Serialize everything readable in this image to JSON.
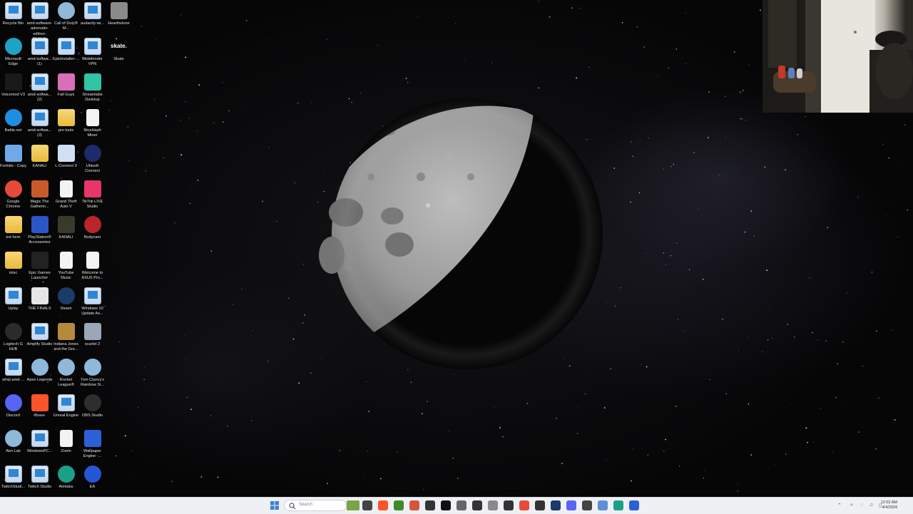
{
  "desktop": {
    "columns": [
      [
        {
          "label": "Recycle Bin",
          "icon": "recycle-bin-icon",
          "style": "file",
          "color": "#dfe9f5"
        },
        {
          "label": "Microsoft Edge",
          "icon": "edge-icon",
          "style": "round",
          "color": "#1fa2c7"
        },
        {
          "label": "Voicemod V3",
          "icon": "voicemod-icon",
          "style": "solid",
          "color": "#1a1a1a"
        },
        {
          "label": "Battle.net",
          "icon": "battlenet-icon",
          "style": "round",
          "color": "#1f8ee0"
        },
        {
          "label": "Fortnite - Copy",
          "icon": "fortnite-icon",
          "style": "solid",
          "color": "#6fa9e8"
        },
        {
          "label": "Google Chrome",
          "icon": "chrome-icon",
          "style": "round",
          "color": "#e84a3a"
        },
        {
          "label": "ext here",
          "icon": "folder-icon",
          "style": "folder",
          "color": "#f0c654"
        },
        {
          "label": "misc",
          "icon": "folder-icon",
          "style": "folder",
          "color": "#f0c654"
        },
        {
          "label": "Uplay",
          "icon": "uplay-icon",
          "style": "file",
          "color": "#dfe9f5"
        },
        {
          "label": "Logitech G HUB",
          "icon": "logitech-icon",
          "style": "round",
          "color": "#2b2b2b"
        },
        {
          "label": "whql-amd-...",
          "icon": "file-icon",
          "style": "file",
          "color": "#dfe9f5"
        },
        {
          "label": "Discord",
          "icon": "discord-icon",
          "style": "round",
          "color": "#5865f2"
        },
        {
          "label": "Aim Lab",
          "icon": "aimlab-icon",
          "style": "round",
          "color": "#8fb9d8"
        },
        {
          "label": "TwitchStudi...",
          "icon": "file-icon",
          "style": "file",
          "color": "#dfe9f5"
        }
      ],
      [
        {
          "label": "amd-software-adrenalin-edition-22.11.2-minimal...",
          "icon": "file-icon",
          "style": "file",
          "color": "#dfe9f5"
        },
        {
          "label": "amd-softwa... (1)",
          "icon": "file-icon",
          "style": "file",
          "color": "#dfe9f5"
        },
        {
          "label": "amd-softwa... (2)",
          "icon": "file-icon",
          "style": "file",
          "color": "#dfe9f5"
        },
        {
          "label": "amd-softwa... (3)",
          "icon": "file-icon",
          "style": "file",
          "color": "#dfe9f5"
        },
        {
          "label": "KANALI",
          "icon": "folder-icon",
          "style": "folder",
          "color": "#f0c654"
        },
        {
          "label": "Magic The Gatherin...",
          "icon": "magic-icon",
          "style": "solid",
          "color": "#c85a2a"
        },
        {
          "label": "PlayStation® Accessories",
          "icon": "playstation-icon",
          "style": "solid",
          "color": "#2a56c6"
        },
        {
          "label": "Epic Games Launcher",
          "icon": "epic-games-icon",
          "style": "solid",
          "color": "#222222"
        },
        {
          "label": "THE FINALS",
          "icon": "the-finals-icon",
          "style": "solid",
          "color": "#e6e6e6"
        },
        {
          "label": "Amplify Studio",
          "icon": "file-icon",
          "style": "file",
          "color": "#dfe9f5"
        },
        {
          "label": "Apex Legends",
          "icon": "apex-icon",
          "style": "round",
          "color": "#8fb9d8"
        },
        {
          "label": "Brave",
          "icon": "brave-icon",
          "style": "solid",
          "color": "#fb542b"
        },
        {
          "label": "WindowsPC...",
          "icon": "file-icon",
          "style": "file",
          "color": "#dfe9f5"
        },
        {
          "label": "Twitch Studio",
          "icon": "file-icon",
          "style": "file",
          "color": "#dfe9f5"
        }
      ],
      [
        {
          "label": "Call of Duty® M...",
          "icon": "call-of-duty-icon",
          "style": "round",
          "color": "#8fb9d8"
        },
        {
          "label": "EpicInstaller-...",
          "icon": "file-icon",
          "style": "file",
          "color": "#dfe9f5"
        },
        {
          "label": "Fall Guys",
          "icon": "fall-guys-icon",
          "style": "solid",
          "color": "#d86fb8"
        },
        {
          "label": "pro tools",
          "icon": "folder-icon",
          "style": "folder",
          "color": "#f0c654"
        },
        {
          "label": "L-Connect 3",
          "icon": "lconnect-icon",
          "style": "solid",
          "color": "#cfe0f5"
        },
        {
          "label": "Grand Theft Auto V",
          "icon": "document-icon",
          "style": "doc",
          "color": "#f3f3f3"
        },
        {
          "label": "KANALI",
          "icon": "kanali-icon",
          "style": "solid",
          "color": "#3a3a2a"
        },
        {
          "label": "YouTube Music",
          "icon": "document-icon",
          "style": "doc",
          "color": "#f3f3f3"
        },
        {
          "label": "Steam",
          "icon": "steam-icon",
          "style": "round",
          "color": "#1b3b6a"
        },
        {
          "label": "Indiana Jones and the Gre...",
          "icon": "indiana-jones-icon",
          "style": "solid",
          "color": "#b58a3a"
        },
        {
          "label": "Rocket League®",
          "icon": "rocket-league-icon",
          "style": "round",
          "color": "#8fb9d8"
        },
        {
          "label": "Unreal Engine",
          "icon": "file-icon",
          "style": "file",
          "color": "#dfe9f5"
        },
        {
          "label": "Zoom",
          "icon": "document-icon",
          "style": "doc",
          "color": "#f3f3f3"
        },
        {
          "label": "Aimlabs",
          "icon": "aimlabs-icon",
          "style": "round",
          "color": "#1aa088"
        }
      ],
      [
        {
          "label": "audacity-wi...",
          "icon": "file-icon",
          "style": "file",
          "color": "#dfe9f5"
        },
        {
          "label": "Bitdefender VPN",
          "icon": "file-icon",
          "style": "file",
          "color": "#dfe9f5"
        },
        {
          "label": "Streamlabs Desktop",
          "icon": "streamlabs-icon",
          "style": "solid",
          "color": "#31c3a2"
        },
        {
          "label": "NiceHash Miner",
          "icon": "document-icon",
          "style": "doc",
          "color": "#f3f3f3"
        },
        {
          "label": "Ubisoft Connect",
          "icon": "ubisoft-icon",
          "style": "round",
          "color": "#1d2a6b"
        },
        {
          "label": "TikTok LIVE Studio",
          "icon": "tiktok-icon",
          "style": "solid",
          "color": "#e8356a"
        },
        {
          "label": "Bodycam",
          "icon": "bodycam-icon",
          "style": "round",
          "color": "#b8262a"
        },
        {
          "label": "Welcome to ASUS Pro...",
          "icon": "document-icon",
          "style": "doc",
          "color": "#f3f3f3"
        },
        {
          "label": "Windows 10 Update As...",
          "icon": "file-icon",
          "style": "file",
          "color": "#dfe9f5"
        },
        {
          "label": "scarlet 2",
          "icon": "scarlet-icon",
          "style": "solid",
          "color": "#9aa7b8"
        },
        {
          "label": "Tom Clancy's Rainbow Si...",
          "icon": "rainbow-six-icon",
          "style": "round",
          "color": "#8fb9d8"
        },
        {
          "label": "OBS Studio",
          "icon": "obs-icon",
          "style": "round",
          "color": "#2e2e2e"
        },
        {
          "label": "Wallpaper Engine -...",
          "icon": "wallpaper-engine-icon",
          "style": "solid",
          "color": "#2d5fd6"
        },
        {
          "label": "EA",
          "icon": "ea-icon",
          "style": "round",
          "color": "#2456d6"
        }
      ],
      [
        {
          "label": "Hearthstone",
          "icon": "hearthstone-icon",
          "style": "solid",
          "color": "#8a8a8a"
        },
        {
          "label": "Skate",
          "icon": "skate-icon",
          "style": "none",
          "color": "#000000",
          "mark": "skate."
        }
      ]
    ]
  },
  "taskbar": {
    "search_placeholder": "Search",
    "clock_time": "12:02 AM",
    "clock_date": "4/4/2024",
    "pinned": [
      {
        "name": "taskbar-landscape-icon",
        "color": "#7da34a"
      },
      {
        "name": "taskbar-file-explorer-icon",
        "color": "#444444"
      },
      {
        "name": "taskbar-brave-icon",
        "color": "#fb542b"
      },
      {
        "name": "taskbar-minecraft-icon",
        "color": "#3f8a2a"
      },
      {
        "name": "taskbar-app-icon",
        "color": "#d8553a"
      },
      {
        "name": "taskbar-pen-icon",
        "color": "#333333"
      },
      {
        "name": "taskbar-terminal-icon",
        "color": "#111111"
      },
      {
        "name": "taskbar-settings-icon",
        "color": "#666666"
      },
      {
        "name": "taskbar-logitech-icon",
        "color": "#333333"
      },
      {
        "name": "taskbar-gear-icon",
        "color": "#8a8a8a"
      },
      {
        "name": "taskbar-monitor-icon",
        "color": "#333333"
      },
      {
        "name": "taskbar-chrome-icon",
        "color": "#e84a3a"
      },
      {
        "name": "taskbar-obs-icon",
        "color": "#333333"
      },
      {
        "name": "taskbar-steam-icon",
        "color": "#1b3b6a"
      },
      {
        "name": "taskbar-discord-icon",
        "color": "#5865f2"
      },
      {
        "name": "taskbar-calculator-icon",
        "color": "#444444"
      },
      {
        "name": "taskbar-pin-icon",
        "color": "#5b8fd6"
      },
      {
        "name": "taskbar-green-app-icon",
        "color": "#1aa088"
      },
      {
        "name": "taskbar-blue-app-icon",
        "color": "#2d5fd6"
      }
    ]
  }
}
